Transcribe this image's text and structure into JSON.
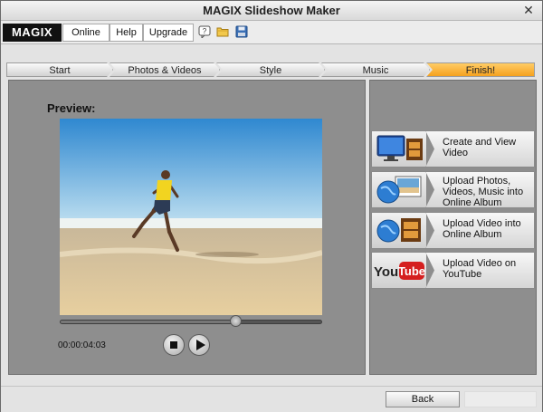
{
  "window": {
    "title": "MAGIX Slideshow Maker"
  },
  "menubar": {
    "logo": "MAGIX",
    "items": [
      "Online",
      "Help",
      "Upgrade"
    ],
    "icons": [
      "help-bubble-icon",
      "folder-open-icon",
      "save-disk-icon"
    ]
  },
  "steps": [
    "Start",
    "Photos & Videos",
    "Style",
    "Music",
    "Finish!"
  ],
  "active_step": "Finish!",
  "preview": {
    "label": "Preview:",
    "time": "00:00:04:03",
    "progress": 0.67
  },
  "actions": [
    {
      "icon": "monitor-film-icon",
      "label": "Create and View Video"
    },
    {
      "icon": "globe-photos-icon",
      "label": "Upload Photos, Videos, Music into Online Album"
    },
    {
      "icon": "globe-film-icon",
      "label": "Upload Video into Online Album"
    },
    {
      "icon": "youtube-logo-icon",
      "label": "Upload Video on YouTube"
    }
  ],
  "footer": {
    "back_label": "Back"
  },
  "colors": {
    "active_step": "#f5a11e",
    "panel": "#8e8e8e",
    "youtube_red": "#d51f1f"
  }
}
